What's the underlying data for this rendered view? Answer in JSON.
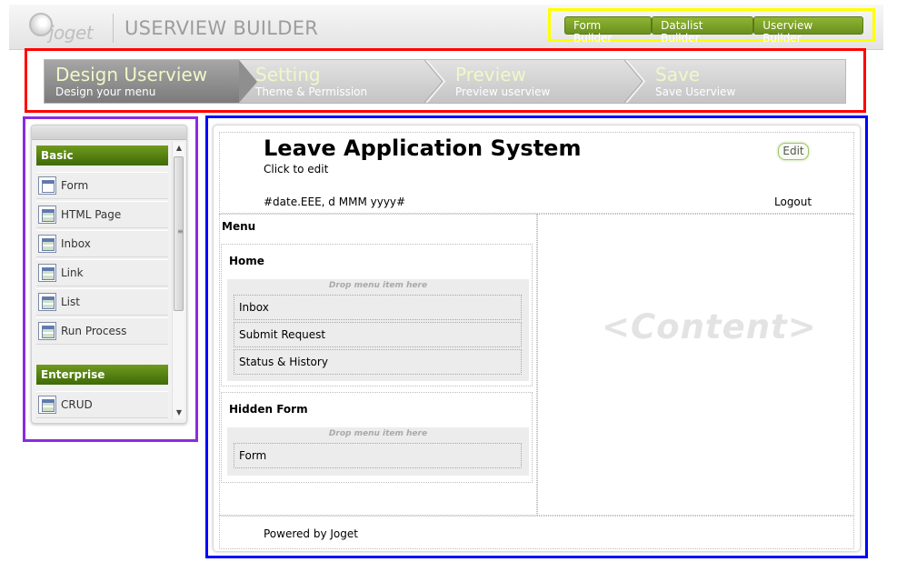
{
  "header": {
    "logo_text": "joget",
    "app_title": "USERVIEW BUILDER",
    "nav": [
      "Form Builder",
      "Datalist Builder",
      "Userview Builder"
    ]
  },
  "steps": [
    {
      "title": "Design Userview",
      "subtitle": "Design your menu"
    },
    {
      "title": "Setting",
      "subtitle": "Theme & Permission"
    },
    {
      "title": "Preview",
      "subtitle": "Preview userview"
    },
    {
      "title": "Save",
      "subtitle": "Save Userview"
    }
  ],
  "palette": {
    "categories": [
      {
        "name": "Basic",
        "items": [
          "Form",
          "HTML Page",
          "Inbox",
          "Link",
          "List",
          "Run Process"
        ]
      },
      {
        "name": "Enterprise",
        "items": [
          "CRUD"
        ]
      }
    ]
  },
  "canvas": {
    "title": "Leave Application System",
    "subtitle": "Click to edit",
    "edit_label": "Edit",
    "date_format": "#date.EEE, d MMM yyyy#",
    "logout": "Logout",
    "menu_label": "Menu",
    "drop_hint": "Drop menu item here",
    "content_placeholder": "<Content>",
    "menu_categories": [
      {
        "name": "Home",
        "items": [
          "Inbox",
          "Submit Request",
          "Status & History"
        ]
      },
      {
        "name": "Hidden Form",
        "items": [
          "Form"
        ]
      }
    ],
    "footer": "Powered by Joget"
  },
  "colors": {
    "accent_green": "#6b8f1e",
    "highlight_yellow": "#ffff00",
    "highlight_red": "#ff0000",
    "highlight_purple": "#8a2be2",
    "highlight_blue": "#0000ff"
  }
}
